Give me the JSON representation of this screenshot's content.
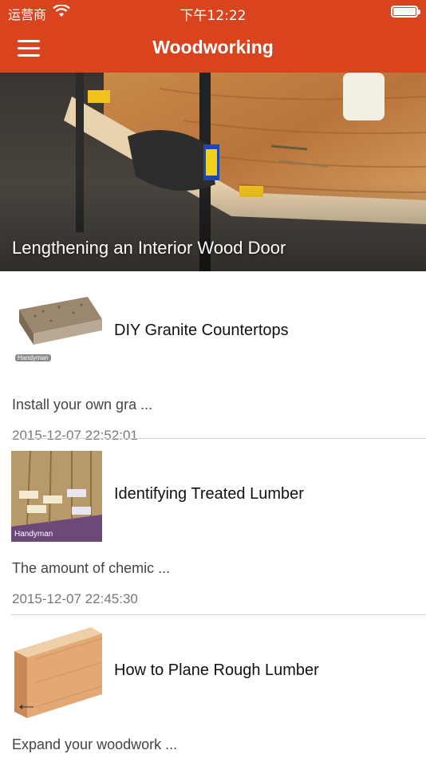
{
  "status_bar": {
    "carrier": "运营商",
    "time": "下午12:22",
    "battery_level": 1.0
  },
  "nav": {
    "title": "Woodworking",
    "menu_icon": "hamburger-menu-icon"
  },
  "hero": {
    "title": "Lengthening an Interior Wood Door"
  },
  "articles": [
    {
      "title": "DIY Granite Countertops",
      "description": "Install your own gra ...",
      "date": "2015-12-07 22:52:01",
      "thumb_caption": "Handyman"
    },
    {
      "title": "Identifying Treated Lumber",
      "description": "The amount of chemic ...",
      "date": "2015-12-07 22:45:30",
      "thumb_caption": "Handyman"
    },
    {
      "title": "How to Plane Rough Lumber",
      "description": "Expand your woodwork ...",
      "date": ""
    }
  ],
  "colors": {
    "accent": "#d9441f"
  }
}
